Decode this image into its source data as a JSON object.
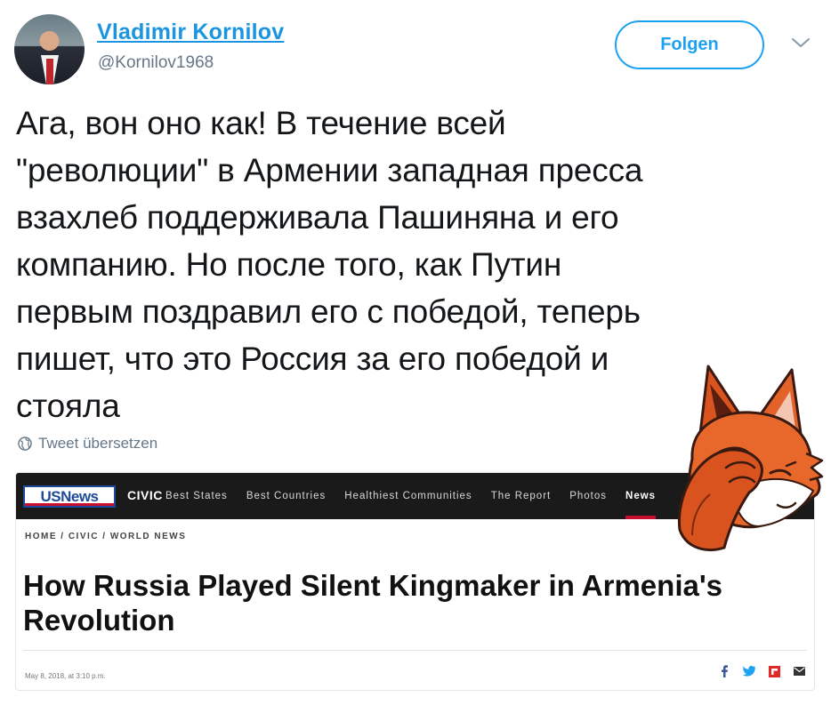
{
  "user": {
    "name": "Vladimir Kornilov",
    "handle": "@Kornilov1968"
  },
  "actions": {
    "follow_label": "Folgen"
  },
  "tweet": {
    "lines": [
      "Ага, вон оно как! В течение всей",
      "\"революции\" в Армении западная пресса",
      "взахлеб поддерживала Пашиняна и его",
      "компанию. Но после того, как Путин",
      "первым поздравил его с победой, теперь",
      "пишет, что это Россия за его победой и",
      "стояла"
    ],
    "translate_label": "Tweet übersetzen"
  },
  "card": {
    "logo_text": "USNews",
    "section": "CIVIC",
    "nav": [
      "Best States",
      "Best Countries",
      "Healthiest Communities",
      "The Report",
      "Photos",
      "News"
    ],
    "active_nav": "News",
    "breadcrumb": "HOME / CIVIC / WORLD NEWS",
    "headline_lines": [
      "How Russia Played Silent Kingmaker in Armenia's",
      "Revolution"
    ],
    "date": "May 8, 2018, at 3:10 p.m."
  },
  "icons": {
    "follow_menu": "chevron-down-icon",
    "translate": "globe-icon",
    "share": [
      "facebook-icon",
      "twitter-icon",
      "flipboard-icon",
      "email-icon"
    ],
    "sticker": "facepalm-fox-sticker"
  },
  "colors": {
    "twitter_blue": "#1da1f2",
    "name_link": "#1b95e0",
    "secondary_text": "#657786",
    "usnews_blue": "#1e4a9c",
    "usnews_red": "#c8102e",
    "nav_bg": "#1a1a1a"
  }
}
